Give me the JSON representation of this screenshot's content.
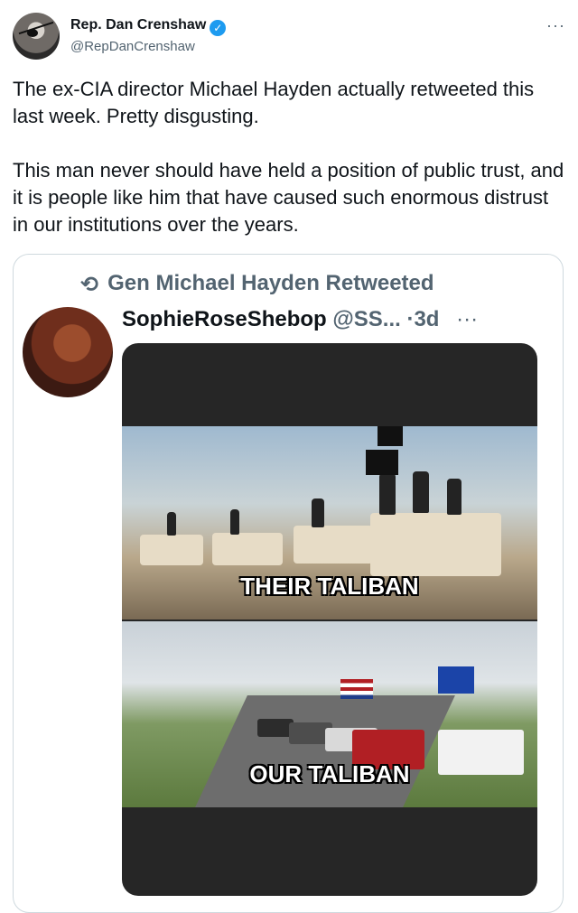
{
  "author": {
    "display_name": "Rep. Dan Crenshaw",
    "handle": "@RepDanCrenshaw",
    "verified_icon": "verified-badge"
  },
  "tweet": {
    "text": "The ex-CIA director Michael Hayden actually retweeted this last week. Pretty disgusting.\n\nThis man never should have held a position of public trust, and it is people like him that have caused such enormous distrust in our institutions over the years."
  },
  "quoted": {
    "retweeted_by": "Gen Michael Hayden Retweeted",
    "display_name": "SophieRoseShebop",
    "handle": "@SS...",
    "dot": "·",
    "time": "3d",
    "more_label": "···"
  },
  "meme": {
    "top_caption": "THEIR TALIBAN",
    "bottom_caption": "OUR TALIBAN"
  },
  "header": {
    "more_label": "···"
  },
  "colors": {
    "verified": "#1d9bf0",
    "muted": "#536471",
    "text": "#0f1419",
    "border": "#cfd9de"
  }
}
